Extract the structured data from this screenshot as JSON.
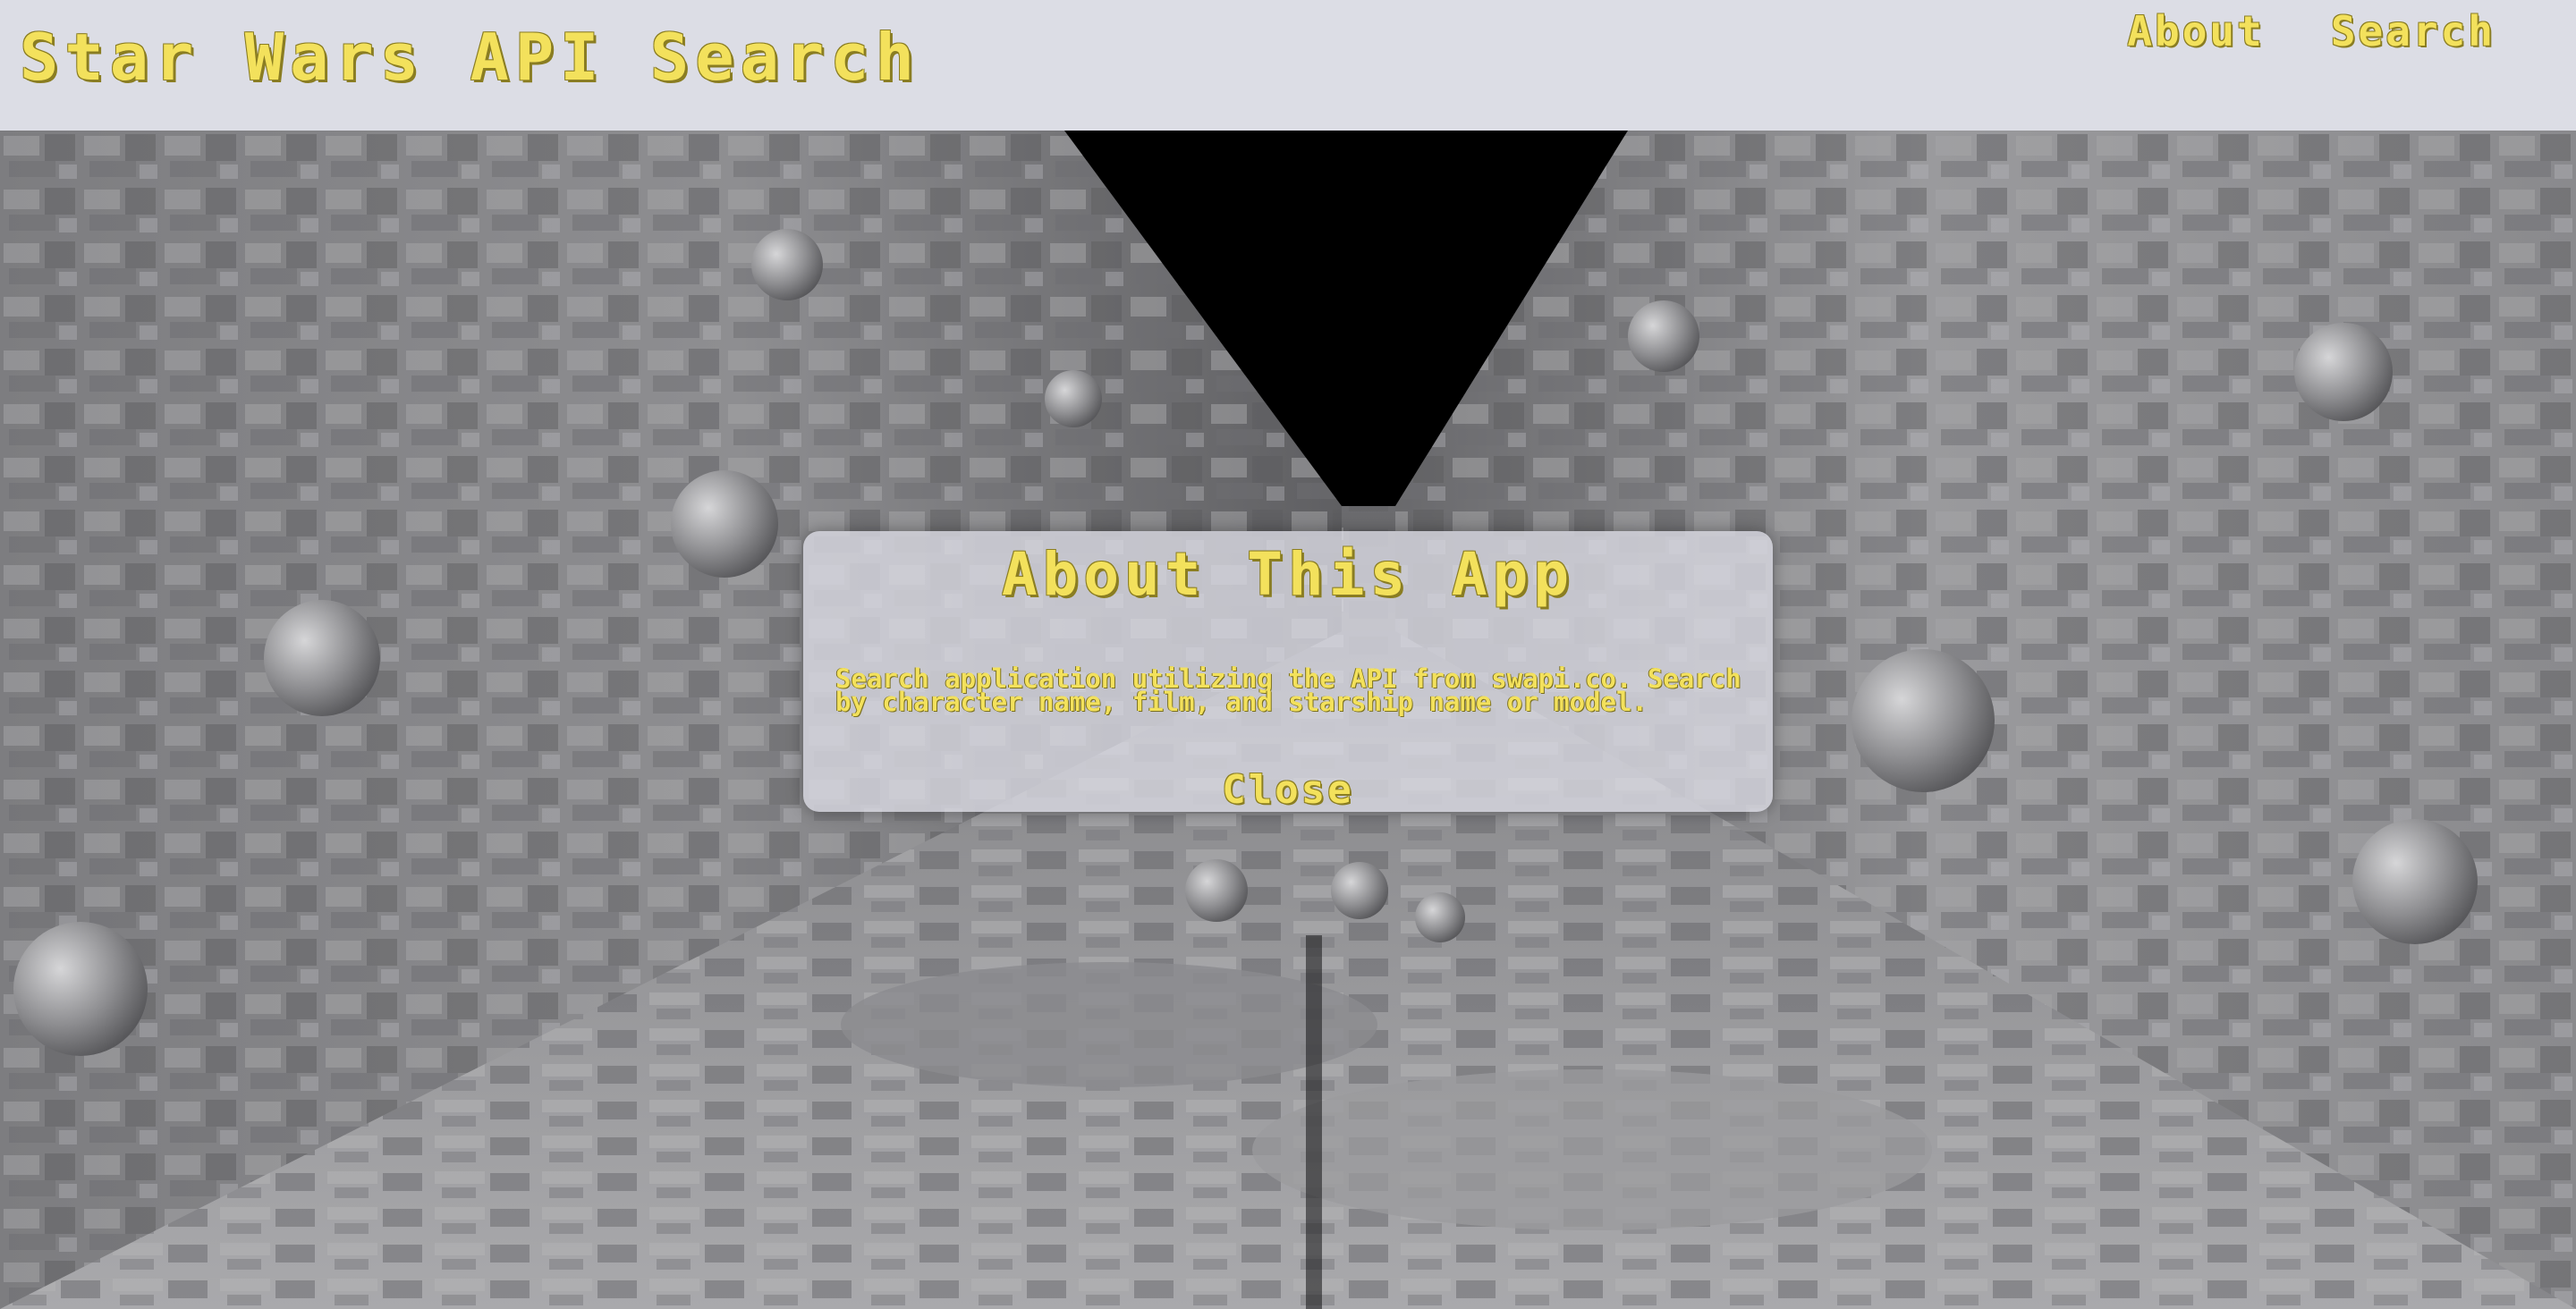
{
  "header": {
    "title": "Star Wars API Search",
    "nav": {
      "about_label": "About",
      "search_label": "Search"
    }
  },
  "modal": {
    "title": "About This App",
    "body": "Search application utilizing the API from swapi.co. Search by character name, film, and starship name or model.",
    "close_label": "Close"
  },
  "colors": {
    "accent_yellow": "#f3e15c",
    "header_background": "#dcdde5",
    "modal_background": "#dadae2"
  },
  "background": {
    "scene": "death-star-trench"
  }
}
